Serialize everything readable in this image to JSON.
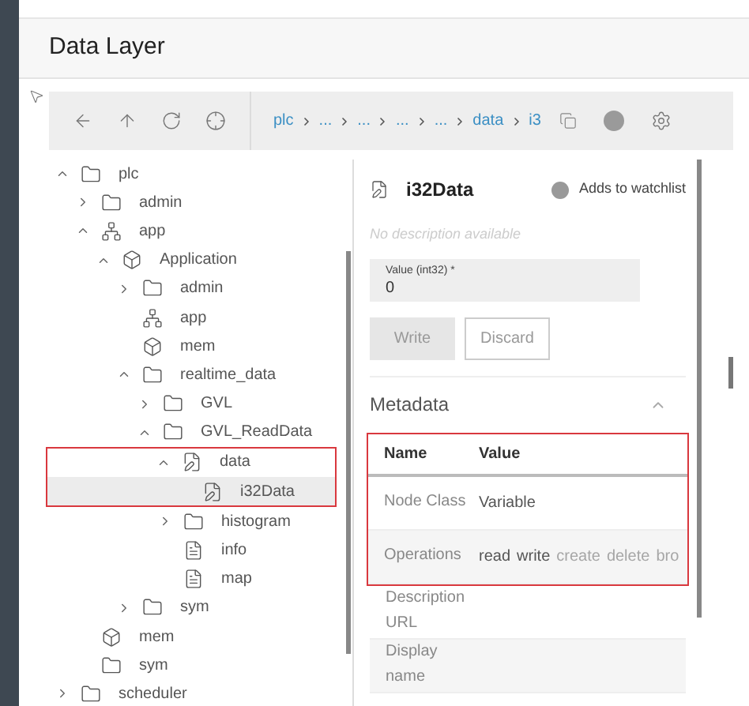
{
  "title": "Data Layer",
  "toolbar": {
    "breadcrumbs": [
      {
        "label": "plc"
      },
      {
        "label": "..."
      },
      {
        "label": "..."
      },
      {
        "label": "..."
      },
      {
        "label": "..."
      },
      {
        "label": "data"
      },
      {
        "label": "i3"
      }
    ]
  },
  "tree": [
    {
      "label": "plc",
      "kind": "folder",
      "expanded": true,
      "selected": false,
      "children": [
        {
          "label": "admin",
          "kind": "folder",
          "expanded": false,
          "selected": false,
          "highlighted": false
        },
        {
          "label": "app",
          "kind": "app",
          "expanded": true,
          "selected": false,
          "children": [
            {
              "label": "Application",
              "kind": "cube",
              "expanded": true,
              "selected": false,
              "children": [
                {
                  "label": "admin",
                  "kind": "folder",
                  "expanded": false,
                  "selected": false,
                  "highlighted": false
                },
                {
                  "label": "app",
                  "kind": "app",
                  "selected": false,
                  "highlighted": false
                },
                {
                  "label": "mem",
                  "kind": "cube",
                  "selected": false,
                  "highlighted": false
                },
                {
                  "label": "realtime_data",
                  "kind": "folder",
                  "expanded": true,
                  "selected": false,
                  "children": [
                    {
                      "label": "GVL",
                      "kind": "folder",
                      "expanded": false,
                      "selected": false,
                      "highlighted": false
                    },
                    {
                      "label": "GVL_ReadData",
                      "kind": "folder",
                      "expanded": true,
                      "selected": false,
                      "children": [
                        {
                          "label": "data",
                          "kind": "variable",
                          "expanded": true,
                          "selected": false,
                          "highlighted": true,
                          "children": [
                            {
                              "label": "i32Data",
                              "kind": "variable",
                              "selected": true,
                              "highlighted": false
                            }
                          ]
                        },
                        {
                          "label": "histogram",
                          "kind": "folder",
                          "expanded": false,
                          "selected": false,
                          "highlighted": false
                        },
                        {
                          "label": "info",
                          "kind": "page",
                          "selected": false,
                          "highlighted": false
                        },
                        {
                          "label": "map",
                          "kind": "page",
                          "selected": false,
                          "highlighted": false
                        }
                      ]
                    }
                  ]
                },
                {
                  "label": "sym",
                  "kind": "folder",
                  "expanded": false,
                  "selected": false,
                  "highlighted": false
                }
              ]
            }
          ]
        },
        {
          "label": "mem",
          "kind": "cube",
          "selected": false,
          "highlighted": false
        },
        {
          "label": "sym",
          "kind": "folder",
          "selected": false,
          "highlighted": false
        }
      ]
    },
    {
      "label": "scheduler",
      "kind": "folder",
      "expanded": false,
      "selected": false,
      "highlighted": false
    }
  ],
  "detail": {
    "title": "i32Data",
    "watchlist": "Adds to watchlist",
    "description": "No description available",
    "field": {
      "label": "Value (int32) *",
      "value": "0"
    },
    "buttons": [
      {
        "label": "Write",
        "disabled": true
      },
      {
        "label": "Discard",
        "disabled": false
      }
    ],
    "metadata": {
      "title": "Metadata",
      "expanded": true,
      "columns": [
        "Name",
        "Value"
      ],
      "rows": [
        {
          "name": "Node Class",
          "highlighted": true,
          "value": [
            {
              "text": "Variable",
              "enabled": true
            }
          ]
        },
        {
          "name": "Operations",
          "highlighted": true,
          "value": [
            {
              "text": "read",
              "enabled": true
            },
            {
              "text": "write",
              "enabled": true
            },
            {
              "text": "create",
              "enabled": false
            },
            {
              "text": "delete",
              "enabled": false
            },
            {
              "text": "bro",
              "enabled": false
            }
          ]
        },
        {
          "name": "Description URL",
          "highlighted": false,
          "value": []
        },
        {
          "name": "Display name",
          "highlighted": false,
          "value": []
        }
      ]
    }
  }
}
